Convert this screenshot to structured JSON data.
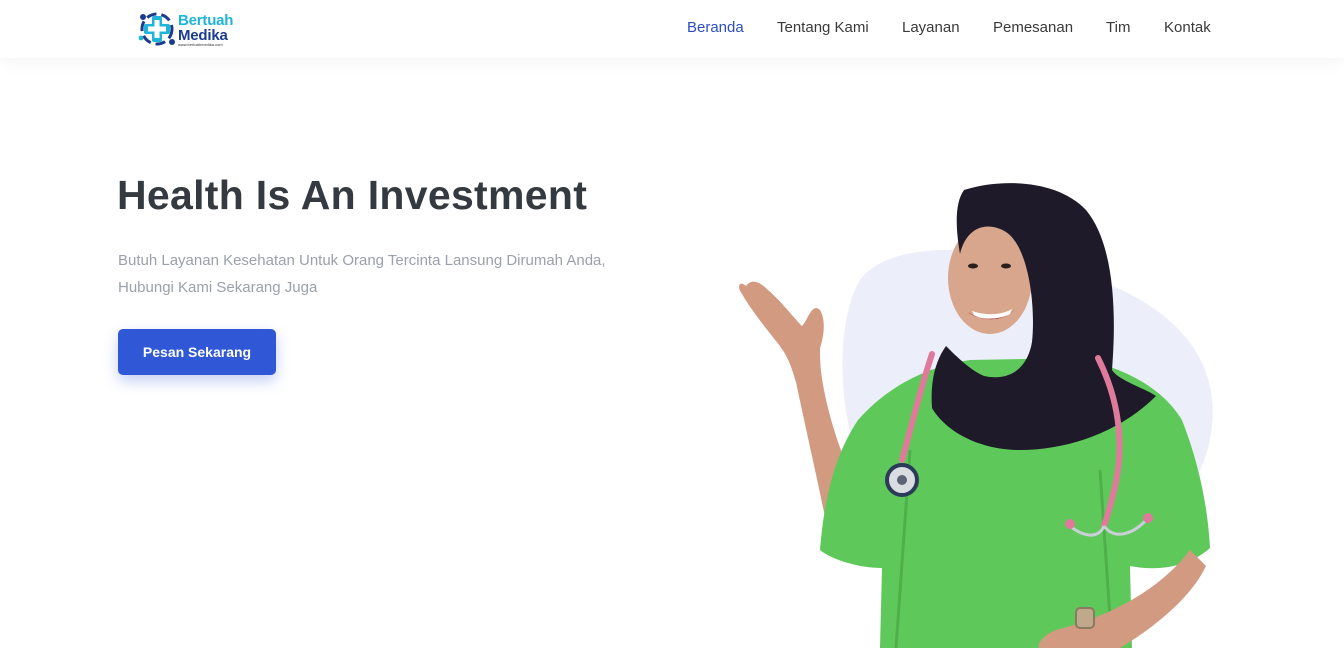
{
  "brand": {
    "name_line1": "Bertuah",
    "name_line2": "Medika",
    "url_text": "www.bertuahmedika.com",
    "colors": {
      "cyan": "#20b4d8",
      "navy": "#1a3b8e"
    }
  },
  "nav": {
    "items": [
      {
        "label": "Beranda",
        "active": true
      },
      {
        "label": "Tentang Kami",
        "active": false
      },
      {
        "label": "Layanan",
        "active": false
      },
      {
        "label": "Pemesanan",
        "active": false
      },
      {
        "label": "Tim",
        "active": false
      },
      {
        "label": "Kontak",
        "active": false
      }
    ]
  },
  "hero": {
    "title": "Health Is An Investment",
    "subtitle_line1": "Butuh Layanan Kesehatan Untuk Orang Tercinta Lansung Dirumah Anda,",
    "subtitle_line2": "Hubungi Kami Sekarang Juga",
    "cta_label": "Pesan Sekarang",
    "image_alt": "nurse-with-stethoscope"
  },
  "colors": {
    "accent": "#2f57d6",
    "nav_active": "#2d4ec3",
    "title": "#343a40",
    "muted_text": "#9aa1aa",
    "blob": "#eceef9",
    "scrubs": "#5ec95a",
    "hijab": "#1f1a2a",
    "stethoscope": "#e07a9a"
  }
}
